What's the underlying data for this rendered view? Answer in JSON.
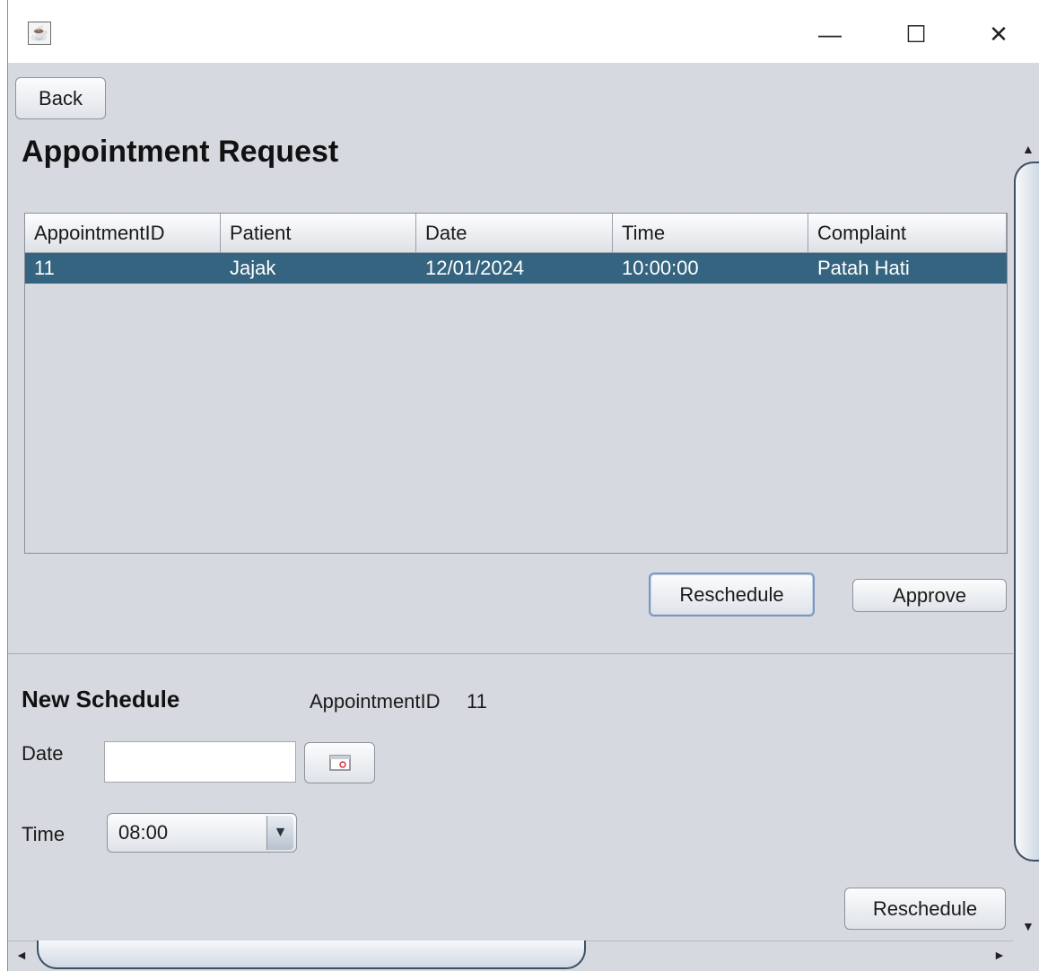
{
  "window": {
    "app_icon": "java-cup-icon",
    "minimize": "—",
    "maximize": "☐",
    "close": "✕"
  },
  "toolbar": {
    "back_label": "Back"
  },
  "page_title": "Appointment Request",
  "table": {
    "columns": [
      "AppointmentID",
      "Patient",
      "Date",
      "Time",
      "Complaint"
    ],
    "rows": [
      [
        "11",
        "Jajak",
        "12/01/2024",
        "10:00:00",
        "Patah Hati"
      ]
    ],
    "selected_row_color": "#34647f"
  },
  "actions": {
    "reschedule_label": "Reschedule",
    "approve_label": "Approve"
  },
  "new_schedule": {
    "title": "New Schedule",
    "appointment_id_label": "AppointmentID",
    "appointment_id_value": "11",
    "date_label": "Date",
    "date_value": "",
    "calendar_icon": "calendar-icon",
    "time_label": "Time",
    "time_value": "08:00",
    "submit_label": "Reschedule"
  }
}
